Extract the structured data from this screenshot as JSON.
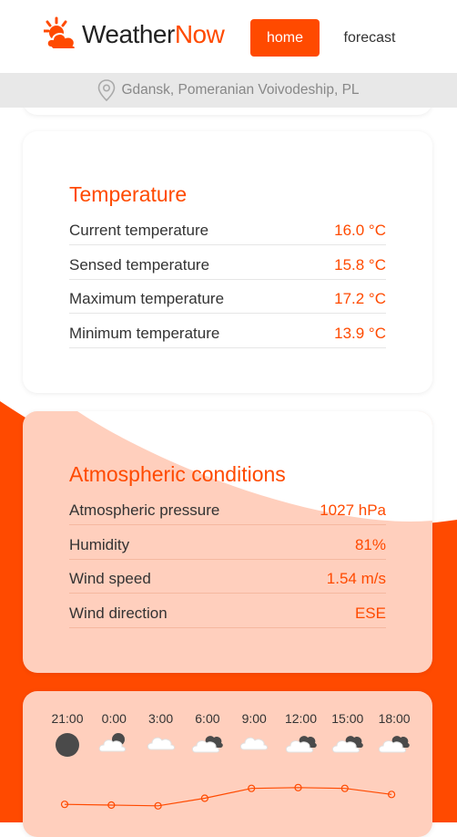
{
  "brand": {
    "name_part1": "Weather",
    "name_part2": "Now"
  },
  "nav": {
    "home": "home",
    "forecast": "forecast"
  },
  "location": "Gdansk, Pomeranian Voivodeship, PL",
  "temperature": {
    "title": "Temperature",
    "rows": [
      {
        "label": "Current temperature",
        "value": "16.0 °C"
      },
      {
        "label": "Sensed temperature",
        "value": "15.8 °C"
      },
      {
        "label": "Maximum temperature",
        "value": "17.2 °C"
      },
      {
        "label": "Minimum temperature",
        "value": "13.9 °C"
      }
    ]
  },
  "atmospheric": {
    "title": "Atmospheric conditions",
    "rows": [
      {
        "label": "Atmospheric pressure",
        "value": "1027 hPa"
      },
      {
        "label": "Humidity",
        "value": "81%"
      },
      {
        "label": "Wind speed",
        "value": "1.54 m/s"
      },
      {
        "label": "Wind direction",
        "value": "ESE"
      }
    ]
  },
  "hourly": {
    "hours": [
      {
        "time": "21:00",
        "icon": "moon-icon"
      },
      {
        "time": "0:00",
        "icon": "cloud-night-icon"
      },
      {
        "time": "3:00",
        "icon": "cloud-icon"
      },
      {
        "time": "6:00",
        "icon": "clouds-icon"
      },
      {
        "time": "9:00",
        "icon": "cloud-icon"
      },
      {
        "time": "12:00",
        "icon": "clouds-icon"
      },
      {
        "time": "15:00",
        "icon": "clouds-icon"
      },
      {
        "time": "18:00",
        "icon": "clouds-icon"
      }
    ]
  },
  "chart_data": {
    "type": "line",
    "x": [
      "21:00",
      "0:00",
      "3:00",
      "6:00",
      "9:00",
      "12:00",
      "15:00",
      "18:00"
    ],
    "values": [
      13.9,
      13.8,
      13.7,
      14.7,
      16.0,
      16.1,
      16.0,
      15.2
    ],
    "ylim": [
      12,
      18
    ]
  },
  "colors": {
    "accent": "#ff4a00",
    "card_tint": "#ffcfbd"
  }
}
